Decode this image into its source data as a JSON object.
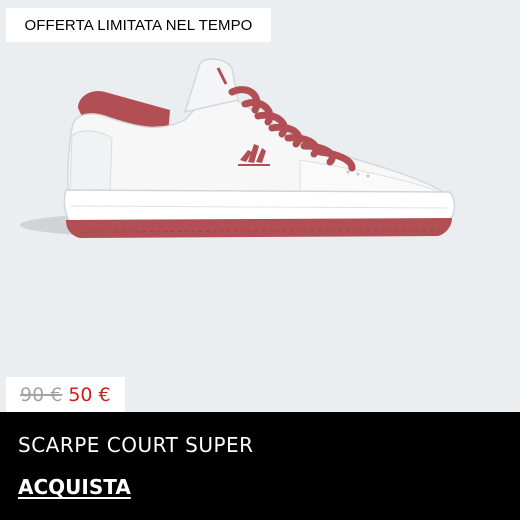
{
  "promo": {
    "label": "OFFERTA LIMITATA NEL TEMPO"
  },
  "product": {
    "name": "SCARPE COURT SUPER",
    "old_price": "90 €",
    "new_price": "50 €",
    "cta": "ACQUISTA",
    "image_icon": "sneaker-image"
  },
  "colors": {
    "background": "#eaeef0",
    "banner": "#000000",
    "accent_red": "#cc1f1f",
    "shoe_white": "#f7f7f8",
    "lace_red": "#b14f55"
  }
}
